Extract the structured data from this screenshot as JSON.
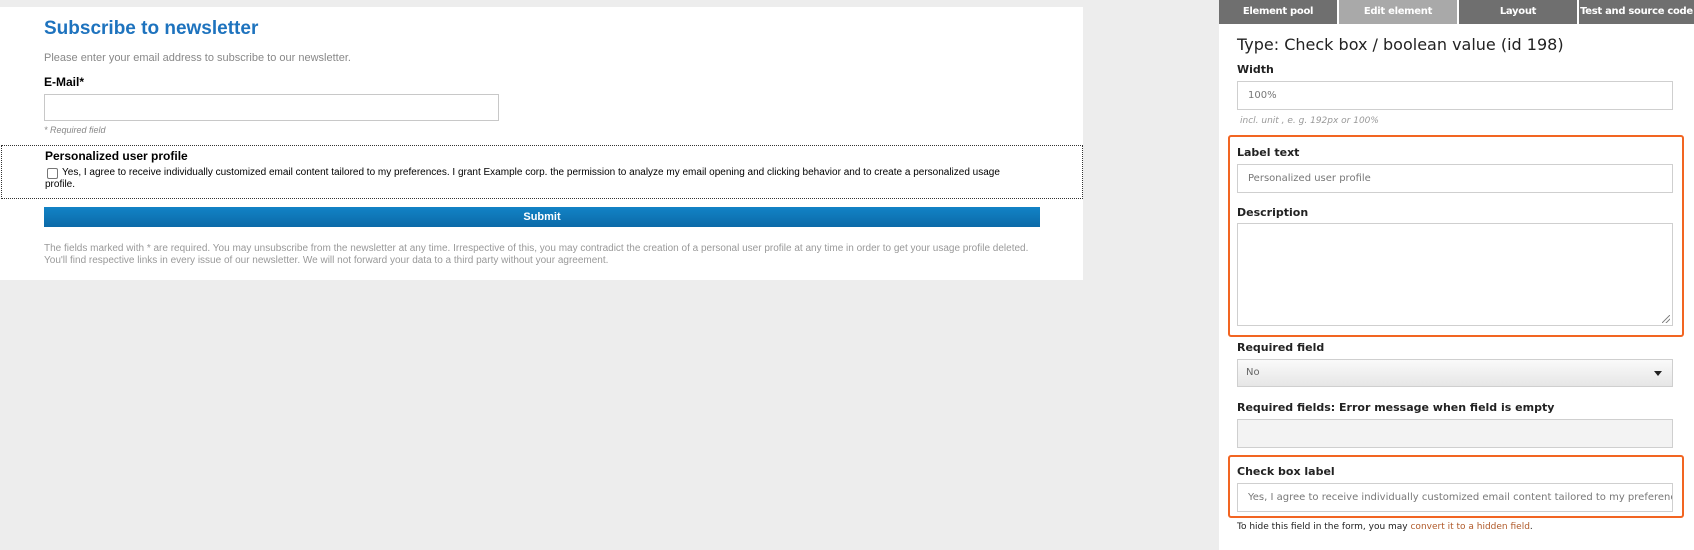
{
  "preview": {
    "title": "Subscribe to newsletter",
    "intro": "Please enter your email address to subscribe to our newsletter.",
    "email_label": "E-Mail*",
    "email_value": "",
    "required_note": "* Required field",
    "profile_title": "Personalized user profile",
    "profile_checked": false,
    "profile_text": "Yes, I agree to receive individually customized email content tailored to my preferences. I grant Example corp. the permission to analyze my email opening and clicking behavior and to create a personalized usage profile.",
    "submit_label": "Submit",
    "footer_note": "The fields marked with * are required. You may unsubscribe from the newsletter at any time. Irrespective of this, you may contradict the creation of a personal user profile at any time in order to get your usage profile deleted. You'll find respective links in every issue of our newsletter. We will not forward your data to a third party without your agreement."
  },
  "panel": {
    "tabs": [
      {
        "label": "Element pool",
        "active": false
      },
      {
        "label": "Edit element",
        "active": true
      },
      {
        "label": "Layout",
        "active": false
      },
      {
        "label": "Test and source code",
        "active": false
      }
    ],
    "title": "Type: Check box / boolean value (id 198)",
    "width_label": "Width",
    "width_value": "100%",
    "width_hint": "incl. unit , e. g. 192px or 100%",
    "label_text_label": "Label text",
    "label_text_value": "Personalized user profile",
    "description_label": "Description",
    "description_value": "",
    "required_label": "Required field",
    "required_value": "No",
    "error_msg_label": "Required fields: Error message when field is empty",
    "error_msg_value": "",
    "checkbox_label_label": "Check box label",
    "checkbox_label_value": "Yes, I agree to receive individually customized email content tailored to my preferences. I grant Example corp. the permission to analyze my email opening and clicking behavior and to create a personalized usage profile.",
    "hide_note_prefix": "To hide this field in the form, you may ",
    "hide_note_link": "convert it to a hidden field",
    "hide_note_suffix": "."
  },
  "colors": {
    "title_blue": "#1e73be",
    "submit_blue": "#0c6aa8",
    "highlight_orange": "#f26522",
    "tab_gray": "#6f6f6f",
    "tab_active_gray": "#a9a9a9"
  }
}
